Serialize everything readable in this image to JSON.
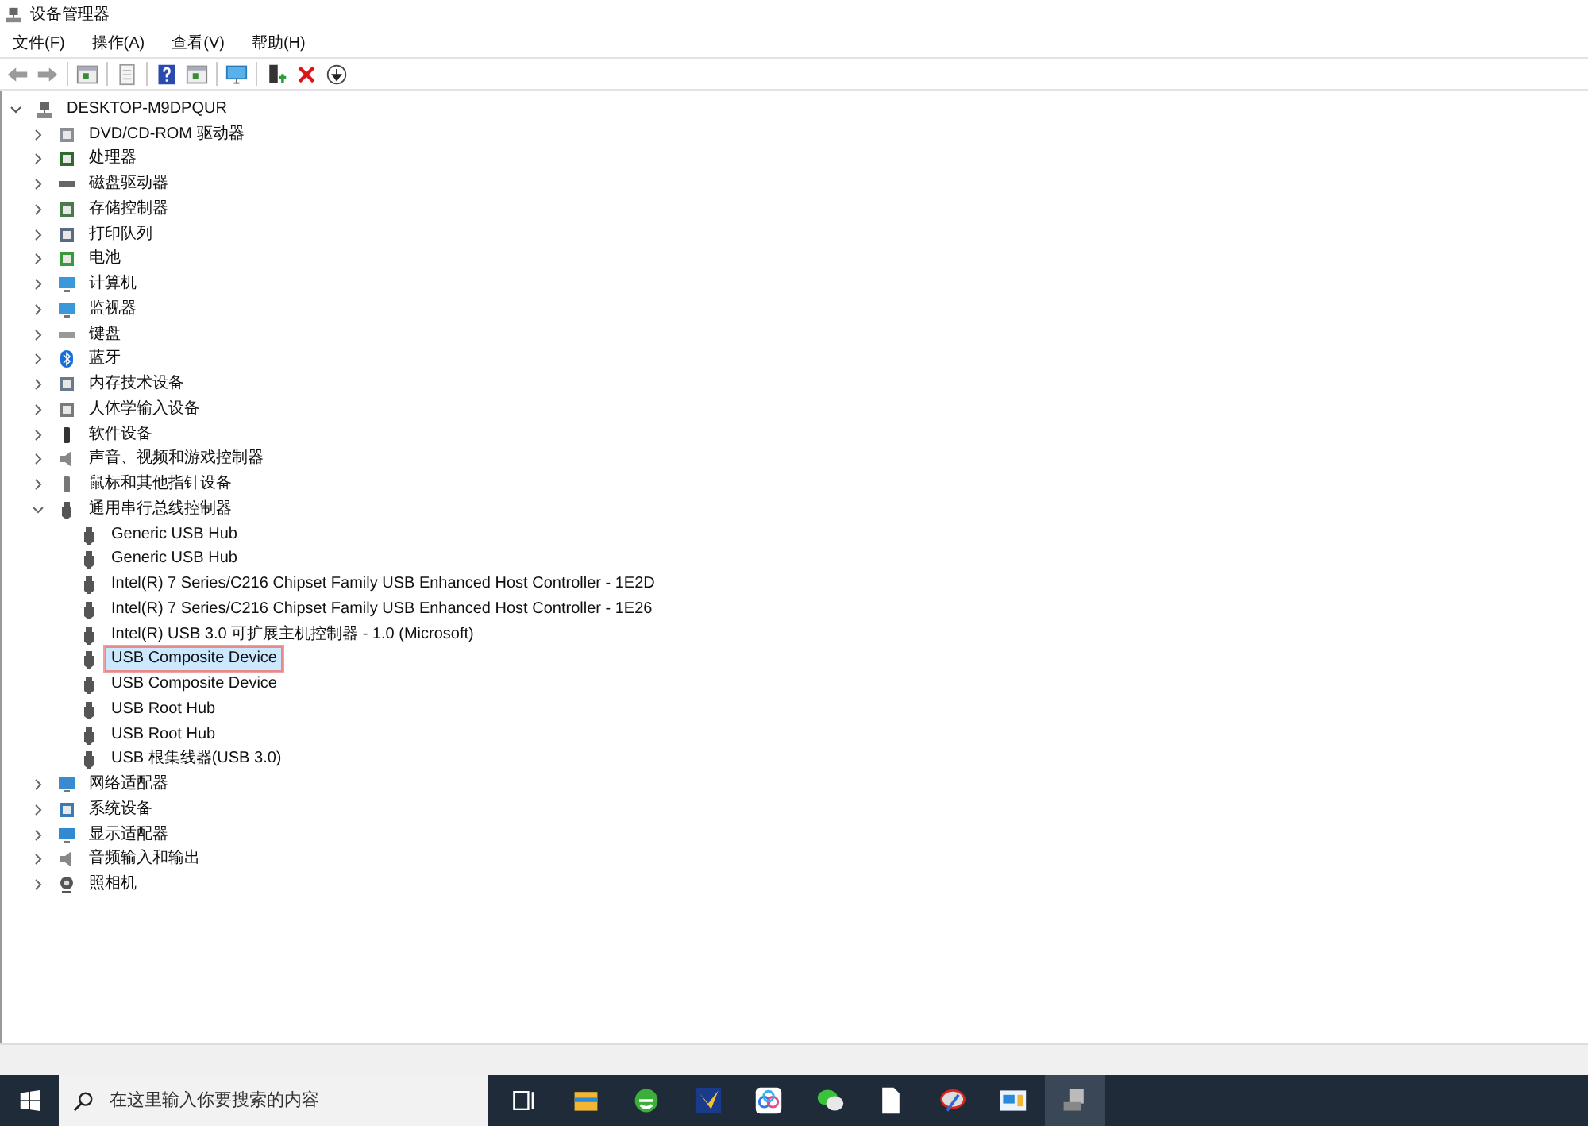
{
  "window": {
    "title": "设备管理器"
  },
  "menu": [
    "文件(F)",
    "操作(A)",
    "查看(V)",
    "帮助(H)"
  ],
  "toolbar": [
    {
      "kind": "back",
      "disabled": true
    },
    {
      "kind": "forward",
      "disabled": true
    },
    {
      "kind": "sep"
    },
    {
      "kind": "panel"
    },
    {
      "kind": "sep"
    },
    {
      "kind": "sheet"
    },
    {
      "kind": "sep"
    },
    {
      "kind": "help"
    },
    {
      "kind": "panel2"
    },
    {
      "kind": "sep"
    },
    {
      "kind": "monitor"
    },
    {
      "kind": "sep"
    },
    {
      "kind": "adddriver"
    },
    {
      "kind": "remove"
    },
    {
      "kind": "download"
    }
  ],
  "tree": {
    "label": "DESKTOP-M9DPQUR",
    "expanded": true,
    "children": [
      {
        "label": "DVD/CD-ROM 驱动器",
        "kind": "disc",
        "expanded": false
      },
      {
        "label": "处理器",
        "kind": "chip",
        "expanded": false
      },
      {
        "label": "磁盘驱动器",
        "kind": "disk",
        "expanded": false
      },
      {
        "label": "存储控制器",
        "kind": "storage",
        "expanded": false
      },
      {
        "label": "打印队列",
        "kind": "printer",
        "expanded": false
      },
      {
        "label": "电池",
        "kind": "battery",
        "expanded": false
      },
      {
        "label": "计算机",
        "kind": "monitor",
        "expanded": false
      },
      {
        "label": "监视器",
        "kind": "monitor",
        "expanded": false
      },
      {
        "label": "键盘",
        "kind": "keyboard",
        "expanded": false
      },
      {
        "label": "蓝牙",
        "kind": "bluetooth",
        "expanded": false
      },
      {
        "label": "内存技术设备",
        "kind": "memory",
        "expanded": false
      },
      {
        "label": "人体学输入设备",
        "kind": "hid",
        "expanded": false
      },
      {
        "label": "软件设备",
        "kind": "software",
        "expanded": false
      },
      {
        "label": "声音、视频和游戏控制器",
        "kind": "speaker",
        "expanded": false
      },
      {
        "label": "鼠标和其他指针设备",
        "kind": "mouse",
        "expanded": false
      },
      {
        "label": "通用串行总线控制器",
        "kind": "usb",
        "expanded": true,
        "children": [
          {
            "label": "Generic USB Hub",
            "selected": false
          },
          {
            "label": "Generic USB Hub",
            "selected": false
          },
          {
            "label": "Intel(R) 7 Series/C216 Chipset Family USB Enhanced Host Controller - 1E2D",
            "selected": false
          },
          {
            "label": "Intel(R) 7 Series/C216 Chipset Family USB Enhanced Host Controller - 1E26",
            "selected": false
          },
          {
            "label": "Intel(R) USB 3.0 可扩展主机控制器 - 1.0 (Microsoft)",
            "selected": false
          },
          {
            "label": "USB Composite Device",
            "selected": true
          },
          {
            "label": "USB Composite Device",
            "selected": false
          },
          {
            "label": "USB Root Hub",
            "selected": false
          },
          {
            "label": "USB Root Hub",
            "selected": false
          },
          {
            "label": "USB 根集线器(USB 3.0)",
            "selected": false
          }
        ]
      },
      {
        "label": "网络适配器",
        "kind": "network",
        "expanded": false
      },
      {
        "label": "系统设备",
        "kind": "system",
        "expanded": false
      },
      {
        "label": "显示适配器",
        "kind": "display",
        "expanded": false
      },
      {
        "label": "音频输入和输出",
        "kind": "speaker",
        "expanded": false
      },
      {
        "label": "照相机",
        "kind": "camera",
        "expanded": false
      }
    ]
  },
  "taskbar": {
    "search": {
      "placeholder": "在这里输入你要搜索的内容"
    },
    "apps": [
      {
        "kind": "taskview",
        "active": false
      },
      {
        "kind": "folder",
        "active": false
      },
      {
        "kind": "ie",
        "active": false
      },
      {
        "kind": "bird",
        "active": false
      },
      {
        "kind": "cloud",
        "active": false
      },
      {
        "kind": "chat",
        "active": false
      },
      {
        "kind": "file",
        "active": false
      },
      {
        "kind": "tool",
        "active": false
      },
      {
        "kind": "board",
        "active": false
      },
      {
        "kind": "devmgr",
        "active": true
      }
    ]
  }
}
